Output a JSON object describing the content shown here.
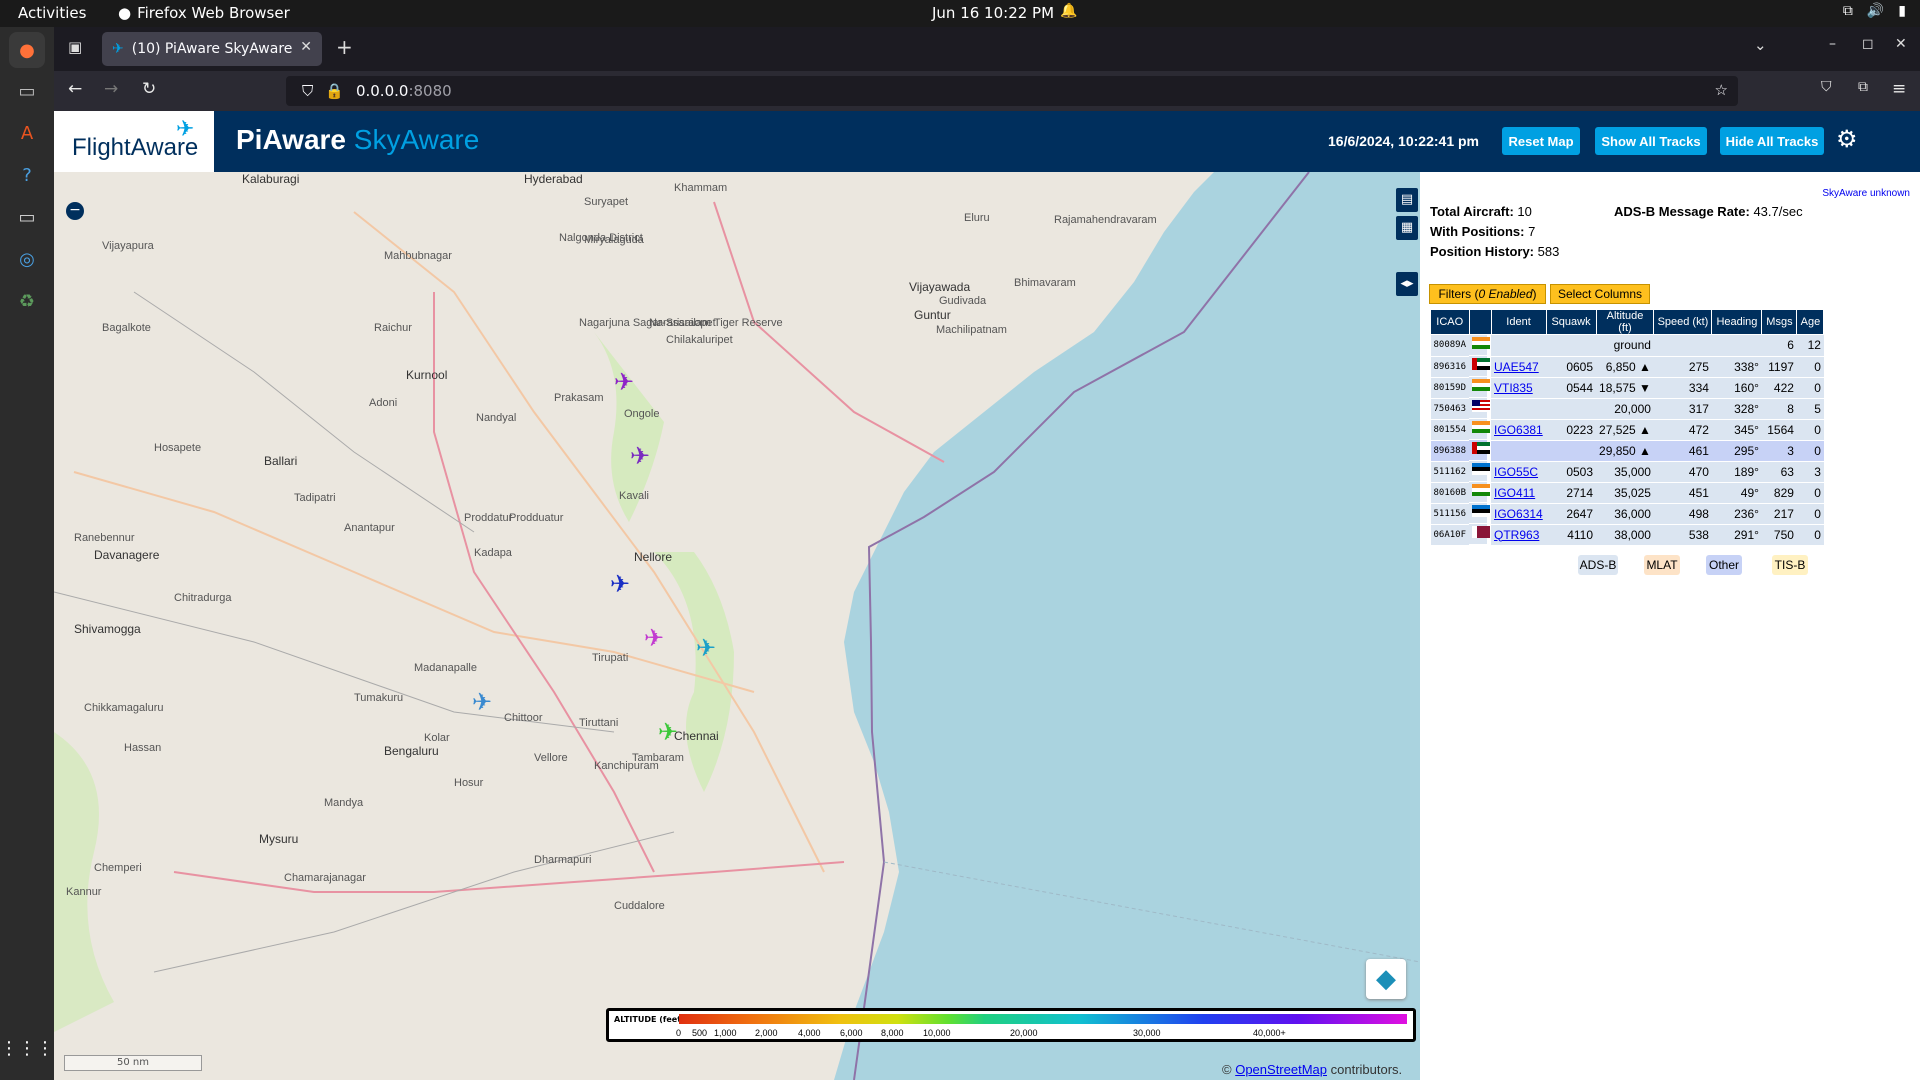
{
  "topbar": {
    "activities": "Activities",
    "app_name": "Firefox Web Browser",
    "clock": "Jun 16  10:22 PM"
  },
  "browser": {
    "tab_title": "(10) PiAware SkyAware",
    "url_host": "0.0.0.0",
    "url_port": ":8080"
  },
  "header": {
    "logo_text": "FlightAware",
    "brand_main": "PiAware",
    "brand_sky": "SkyAware",
    "datetime": "16/6/2024, 10:22:41 pm",
    "reset_map": "Reset Map",
    "show_tracks": "Show All Tracks",
    "hide_tracks": "Hide All Tracks"
  },
  "map": {
    "cities": [
      {
        "name": "Kalaburagi",
        "big": true
      },
      {
        "name": "Hyderabad",
        "big": true
      },
      {
        "name": "Khammam",
        "big": false
      },
      {
        "name": "Suryapet",
        "big": false
      },
      {
        "name": "Vijayapura",
        "big": false
      },
      {
        "name": "Mahbubnagar",
        "big": false
      },
      {
        "name": "Nalgonda District",
        "big": false
      },
      {
        "name": "Miryalaguda",
        "big": false
      },
      {
        "name": "Eluru",
        "big": false
      },
      {
        "name": "Rajamahendravaram",
        "big": false
      },
      {
        "name": "Vijayawada",
        "big": true
      },
      {
        "name": "Guntur",
        "big": true
      },
      {
        "name": "Bagalkote",
        "big": false
      },
      {
        "name": "Raichur",
        "big": false
      },
      {
        "name": "Kurnool",
        "big": true
      },
      {
        "name": "Narasaraopet",
        "big": false
      },
      {
        "name": "Chilakaluripet",
        "big": false
      },
      {
        "name": "Machilipatnam",
        "big": false
      },
      {
        "name": "Bhimavaram",
        "big": false
      },
      {
        "name": "Gudivada",
        "big": false
      },
      {
        "name": "Nagarjuna Sagar-Srisailam Tiger Reserve",
        "big": false
      },
      {
        "name": "Adoni",
        "big": false
      },
      {
        "name": "Nandyal",
        "big": false
      },
      {
        "name": "Prakasam",
        "big": false
      },
      {
        "name": "Ongole",
        "big": false
      },
      {
        "name": "Ballari",
        "big": true
      },
      {
        "name": "Hosapete",
        "big": false
      },
      {
        "name": "Tadipatri",
        "big": false
      },
      {
        "name": "Proddatur",
        "big": false
      },
      {
        "name": "Kavali",
        "big": false
      },
      {
        "name": "Ranebennur",
        "big": false
      },
      {
        "name": "Anantapur",
        "big": false
      },
      {
        "name": "Davanagere",
        "big": true
      },
      {
        "name": "Kadapa",
        "big": false
      },
      {
        "name": "Nellore",
        "big": true
      },
      {
        "name": "Chitradurga",
        "big": false
      },
      {
        "name": "Shivamogga",
        "big": true
      },
      {
        "name": "Tirupati",
        "big": false
      },
      {
        "name": "Madanapalle",
        "big": false
      },
      {
        "name": "Tumakuru",
        "big": false
      },
      {
        "name": "Chikkamagaluru",
        "big": false
      },
      {
        "name": "Kolar",
        "big": false
      },
      {
        "name": "Chittoor",
        "big": false
      },
      {
        "name": "Tiruttani",
        "big": false
      },
      {
        "name": "Chennai",
        "big": true
      },
      {
        "name": "Hassan",
        "big": false
      },
      {
        "name": "Bengaluru",
        "big": true
      },
      {
        "name": "Vellore",
        "big": false
      },
      {
        "name": "Tambaram",
        "big": false
      },
      {
        "name": "Kanchipuram",
        "big": false
      },
      {
        "name": "Hosur",
        "big": false
      },
      {
        "name": "Mandya",
        "big": false
      },
      {
        "name": "Mysuru",
        "big": true
      },
      {
        "name": "Dharmapuri",
        "big": false
      },
      {
        "name": "Chamarajanagar",
        "big": false
      },
      {
        "name": "Kannur",
        "big": false
      },
      {
        "name": "Cuddalore",
        "big": false
      },
      {
        "name": "Chemperi",
        "big": false
      },
      {
        "name": "Prodduatur",
        "big": false
      }
    ],
    "planes": [
      {
        "color": "#8e24c8"
      },
      {
        "color": "#7a2bc0"
      },
      {
        "color": "#1a2fc4"
      },
      {
        "color": "#c23bd0"
      },
      {
        "color": "#1ba0c8"
      },
      {
        "color": "#3a8ad0"
      },
      {
        "color": "#3cc83a"
      }
    ],
    "altitude_label": "ALTITUDE (feet)",
    "altitude_ticks": [
      "0",
      "500",
      "1,000",
      "2,000",
      "4,000",
      "6,000",
      "8,000",
      "10,000",
      "20,000",
      "30,000",
      "40,000+"
    ],
    "scale": "50 nm",
    "attribution_prefix": "©",
    "attribution_link": "OpenStreetMap",
    "attribution_suffix": "contributors."
  },
  "sidebar": {
    "version": "SkyAware unknown",
    "total_label": "Total Aircraft:",
    "total": "10",
    "withpos_label": "With Positions:",
    "withpos": "7",
    "history_label": "Position History:",
    "history": "583",
    "rate_label": "ADS-B Message Rate:",
    "rate": "43.7/sec",
    "filters_prefix": "Filters (",
    "filters_italic": "0 Enabled",
    "filters_suffix": ")",
    "select_columns": "Select Columns",
    "columns": [
      "ICAO",
      "",
      "Ident",
      "Squawk",
      "Altitude (ft)",
      "Speed (kt)",
      "Heading",
      "Msgs",
      "Age"
    ],
    "rows": [
      {
        "icao": "80089A",
        "flag": "IN",
        "ident": "",
        "squawk": "",
        "alt": "ground",
        "speed": "",
        "heading": "",
        "msgs": "6",
        "age": "12",
        "type": "adsb"
      },
      {
        "icao": "896316",
        "flag": "AE",
        "ident": "UAE547",
        "squawk": "0605",
        "alt": "6,850 ▲",
        "speed": "275",
        "heading": "338°",
        "msgs": "1197",
        "age": "0",
        "type": "adsb"
      },
      {
        "icao": "80159D",
        "flag": "IN",
        "ident": "VTI835",
        "squawk": "0544",
        "alt": "18,575 ▼",
        "speed": "334",
        "heading": "160°",
        "msgs": "422",
        "age": "0",
        "type": "adsb"
      },
      {
        "icao": "750463",
        "flag": "MY",
        "ident": "",
        "squawk": "",
        "alt": "20,000",
        "speed": "317",
        "heading": "328°",
        "msgs": "8",
        "age": "5",
        "type": "adsb"
      },
      {
        "icao": "801554",
        "flag": "IN",
        "ident": "IGO6381",
        "squawk": "0223",
        "alt": "27,525 ▲",
        "speed": "472",
        "heading": "345°",
        "msgs": "1564",
        "age": "0",
        "type": "adsb"
      },
      {
        "icao": "896388",
        "flag": "AE",
        "ident": "",
        "squawk": "",
        "alt": "29,850 ▲",
        "speed": "461",
        "heading": "295°",
        "msgs": "3",
        "age": "0",
        "type": "oth"
      },
      {
        "icao": "511162",
        "flag": "EE",
        "ident": "IGO55C",
        "squawk": "0503",
        "alt": "35,000",
        "speed": "470",
        "heading": "189°",
        "msgs": "63",
        "age": "3",
        "type": "adsb"
      },
      {
        "icao": "80160B",
        "flag": "IN",
        "ident": "IGO411",
        "squawk": "2714",
        "alt": "35,025",
        "speed": "451",
        "heading": "49°",
        "msgs": "829",
        "age": "0",
        "type": "adsb"
      },
      {
        "icao": "511156",
        "flag": "EE",
        "ident": "IGO6314",
        "squawk": "2647",
        "alt": "36,000",
        "speed": "498",
        "heading": "236°",
        "msgs": "217",
        "age": "0",
        "type": "adsb"
      },
      {
        "icao": "06A10F",
        "flag": "QA",
        "ident": "QTR963",
        "squawk": "4110",
        "alt": "38,000",
        "speed": "538",
        "heading": "291°",
        "msgs": "750",
        "age": "0",
        "type": "adsb"
      }
    ],
    "legend": [
      {
        "label": "ADS-B",
        "bg": "#dbe5f1"
      },
      {
        "label": "MLAT",
        "bg": "#fde3c7"
      },
      {
        "label": "Other",
        "bg": "#c7d2f6"
      },
      {
        "label": "TIS-B",
        "bg": "#fff1c2"
      }
    ]
  }
}
